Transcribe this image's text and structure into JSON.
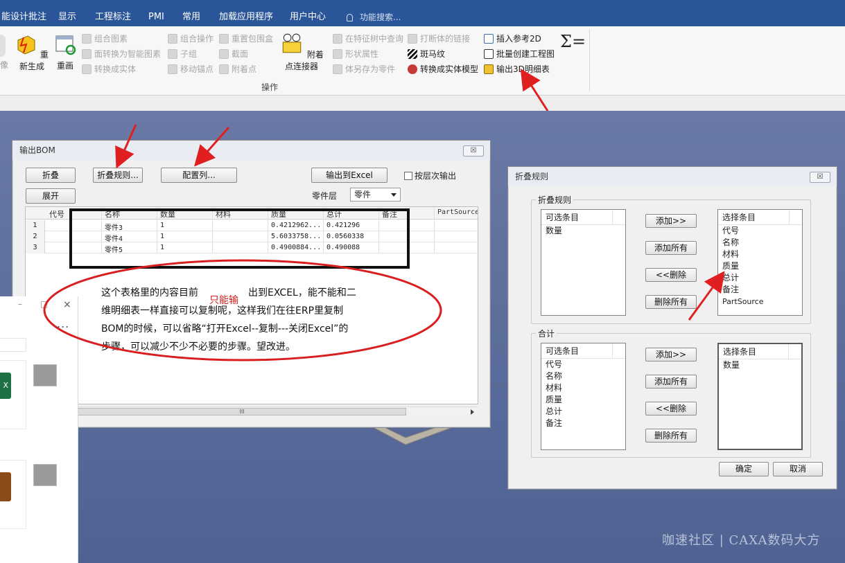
{
  "menubar": {
    "items": [
      "能设计批注",
      "显示",
      "工程标注",
      "PMI",
      "常用",
      "加载应用程序",
      "用户中心"
    ],
    "search_placeholder": "功能搜索..."
  },
  "ribbon": {
    "big_buttons": [
      "像",
      "重新生成",
      "重画",
      "附着点连接器"
    ],
    "col1": [
      "组合图素",
      "面转换为智能图素",
      "转换成实体"
    ],
    "col2": [
      "组合操作",
      "子组",
      "移动锚点"
    ],
    "col3": [
      "重置包围盒",
      "截面",
      "附着点"
    ],
    "col4": [
      "在特征树中查询",
      "形状属性",
      "体另存为零件"
    ],
    "col5": [
      "打断体的链接",
      "斑马纹",
      "转换成实体模型"
    ],
    "col6": [
      "插入参考2D",
      "批量创建工程图",
      "输出3D明细表"
    ],
    "sigma_label": "Σ=",
    "group_label": "操作"
  },
  "bom_dialog": {
    "title": "输出BOM",
    "close": "☒",
    "fold_button": "折叠",
    "expand_button": "展开",
    "fold_rule_button": "折叠规则...",
    "config_columns_button": "配置列...",
    "export_excel_button": "输出到Excel",
    "hierarchy_checkbox": "按层次输出",
    "part_level_label": "零件层",
    "part_level_value": "零件",
    "columns": [
      "代号",
      "名称",
      "数量",
      "材料",
      "质量",
      "总计",
      "备注",
      "PartSource"
    ],
    "rows": [
      {
        "num": "1",
        "name": "零件3",
        "qty": "1",
        "mass": "0.4212962...",
        "total": "0.421296"
      },
      {
        "num": "2",
        "name": "零件4",
        "qty": "1",
        "mass": "5.6033758...",
        "total": "0.0560338"
      },
      {
        "num": "3",
        "name": "零件5",
        "qty": "1",
        "mass": "0.4900884...",
        "total": "0.490088"
      }
    ],
    "scroll_thumb": "III"
  },
  "annotation": {
    "line1a": "这个表格里的内容目前",
    "line1b": "出到EXCEL，能不能和二",
    "inserted": "只能输",
    "line2": "维明细表一样直接可以复制呢，这样我们在往ERP里复制",
    "line3": "BOM的时候，可以省略“打开Excel--复制---关闭Excel”的",
    "line4": "步骤，可以减少不少不必要的步骤。望改进。"
  },
  "fold_dialog": {
    "title": "折叠规则",
    "close": "☒",
    "fold_group": "折叠规则",
    "sum_group": "合计",
    "available_header": "可选条目",
    "selected_header": "选择条目",
    "fold_available": [
      "数量"
    ],
    "fold_selected": [
      "代号",
      "名称",
      "材料",
      "质量",
      "总计",
      "备注",
      "PartSource"
    ],
    "sum_available": [
      "代号",
      "名称",
      "材料",
      "质量",
      "总计",
      "备注"
    ],
    "sum_selected": [
      "数量"
    ],
    "add": "添加>>",
    "add_all": "添加所有",
    "remove": "<<删除",
    "remove_all": "删除所有",
    "ok": "确定",
    "cancel": "取消"
  },
  "side_panel": {
    "min": "–",
    "max": "□",
    "close": "×",
    "more": "..."
  },
  "watermark": "咖速社区 | CAXA数码大方",
  "colors": {
    "menubar": "#2a5699",
    "workspace": "#5e6f9e",
    "arrow": "#e02020",
    "ellipse": "#d81e1e"
  }
}
